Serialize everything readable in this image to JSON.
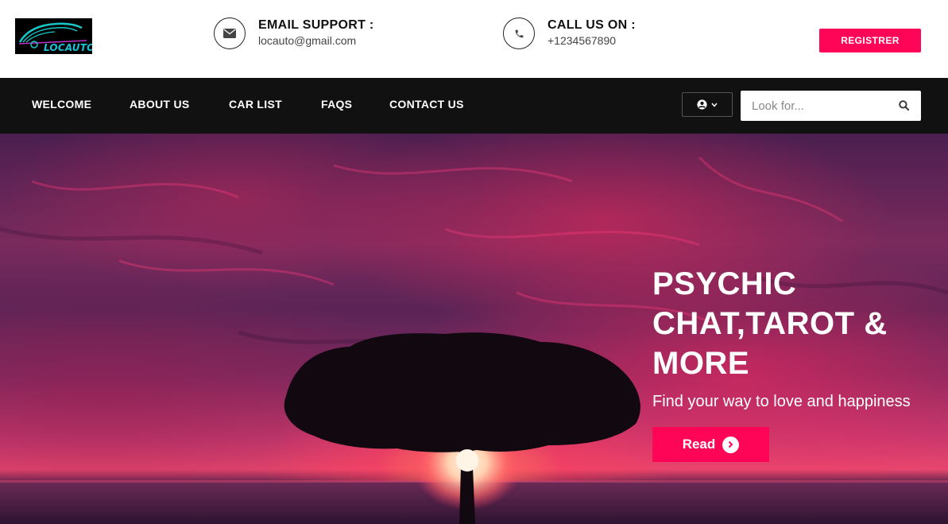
{
  "header": {
    "logo_text": "LOCAUTO",
    "email": {
      "title": "EMAIL SUPPORT :",
      "value": "locauto@gmail.com",
      "icon": "envelope-icon"
    },
    "phone": {
      "title": "CALL US ON :",
      "value": "+1234567890",
      "icon": "phone-icon"
    },
    "register_label": "REGISTRER"
  },
  "nav": {
    "items": [
      {
        "label": "WELCOME"
      },
      {
        "label": "ABOUT US"
      },
      {
        "label": "CAR LIST"
      },
      {
        "label": "FAQS"
      },
      {
        "label": "CONTACT US"
      }
    ],
    "user_icon": "user-circle-icon",
    "search_placeholder": "Look for..."
  },
  "hero": {
    "title": "PSYCHIC CHAT,TAROT & MORE",
    "subtitle": "Find your way to love and happiness",
    "button_label": "Read"
  },
  "colors": {
    "accent": "#ff0558",
    "nav_background": "#111111",
    "logo_accent": "#18c3d6"
  }
}
